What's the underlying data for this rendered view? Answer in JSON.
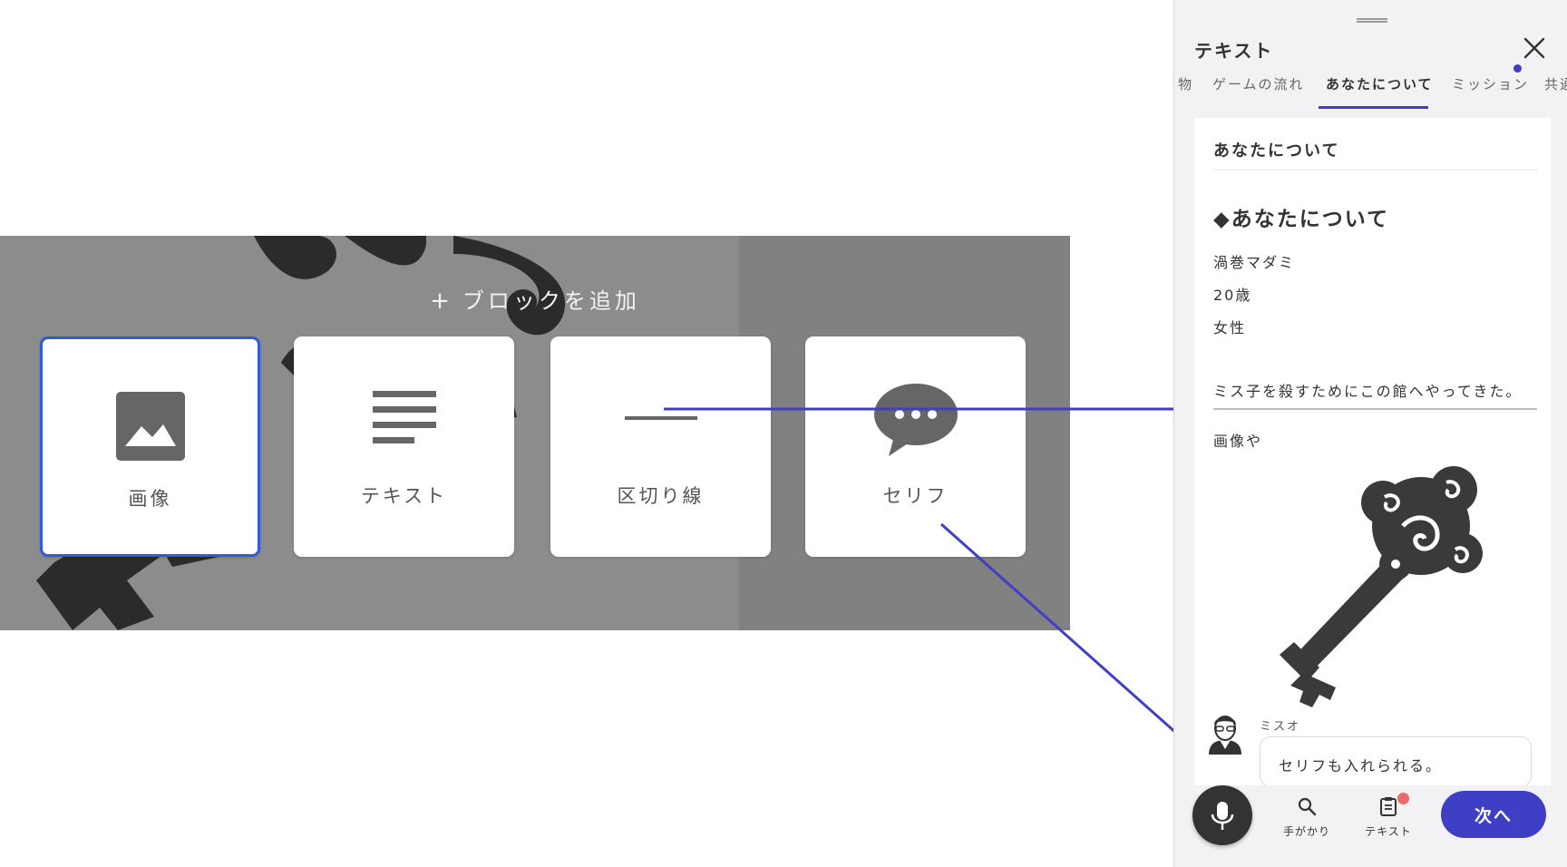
{
  "editor": {
    "add_block_label": "ブロックを追加",
    "blocks": [
      {
        "label": "画像",
        "icon": "image-icon",
        "selected": true
      },
      {
        "label": "テキスト",
        "icon": "text-lines-icon",
        "selected": false
      },
      {
        "label": "区切り線",
        "icon": "divider-line-icon",
        "selected": false
      },
      {
        "label": "セリフ",
        "icon": "speech-bubble-icon",
        "selected": false
      }
    ]
  },
  "panel": {
    "title": "テキスト",
    "tabs": [
      "物",
      "ゲームの流れ",
      "あなたについて",
      "ミッション",
      "共通"
    ],
    "active_tab": "あなたについて",
    "section_heading": "あなたについて",
    "big_heading": "◆あなたについて",
    "lines": [
      "渦巻マダミ",
      "20歳",
      "女性",
      "ミス子を殺すためにこの館へやってきた。"
    ],
    "after_divider": "画像や",
    "speaker_name": "ミスオ",
    "speech_text": "セリフも入れられる。",
    "nav": {
      "clues_label": "手がかり",
      "text_label": "テキスト",
      "next_label": "次へ"
    }
  },
  "colors": {
    "accent": "#3f3fc5",
    "selected_border": "#2f5bd6",
    "badge": "#e86a6a",
    "editor_bg": "#8c8c8c",
    "arrow": "#3f3fc5"
  }
}
